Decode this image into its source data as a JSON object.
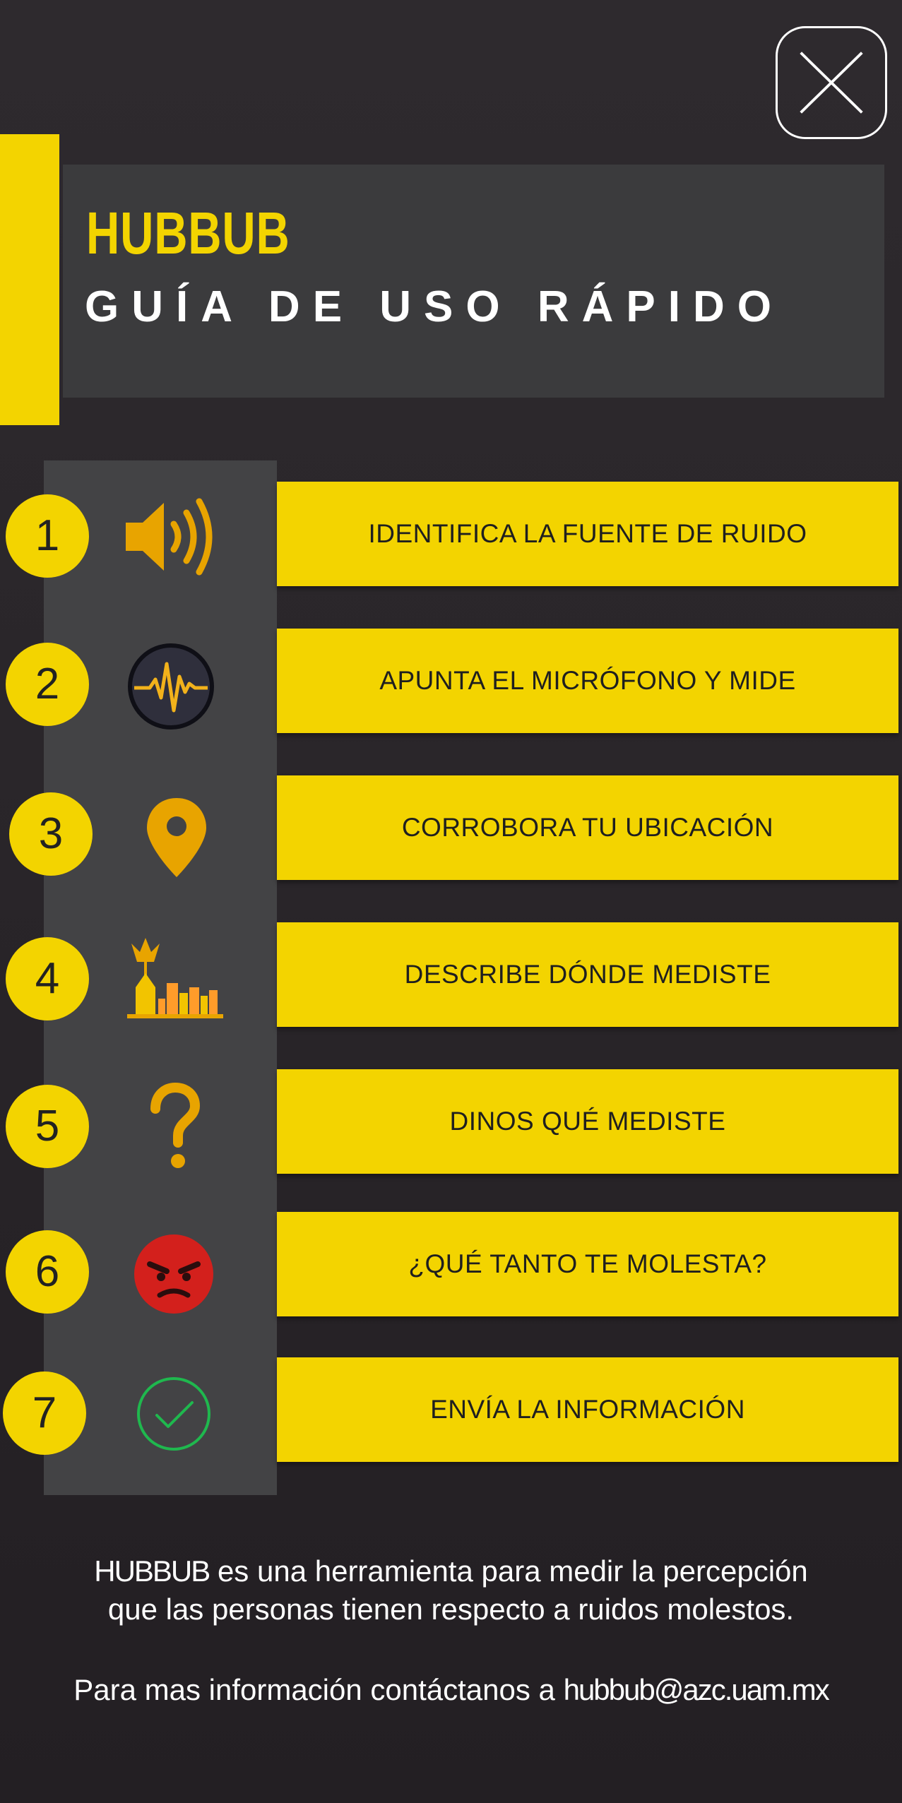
{
  "header": {
    "app_name": "HUBBUB",
    "title": "GUÍA DE USO RÁPIDO"
  },
  "close_button": {
    "icon": "close-icon"
  },
  "steps": [
    {
      "number": "1",
      "label": "IDENTIFICA LA FUENTE DE RUIDO",
      "icon": "speaker-icon"
    },
    {
      "number": "2",
      "label": "APUNTA EL MICRÓFONO Y MIDE",
      "icon": "sound-wave-icon"
    },
    {
      "number": "3",
      "label": "CORROBORA TU UBICACIÓN",
      "icon": "location-pin-icon"
    },
    {
      "number": "4",
      "label": "DESCRIBE DÓNDE MEDISTE",
      "icon": "city-skyline-icon"
    },
    {
      "number": "5",
      "label": "DINOS QUÉ MEDISTE",
      "icon": "question-mark-icon"
    },
    {
      "number": "6",
      "label": "¿QUÉ TANTO TE MOLESTA?",
      "icon": "angry-face-icon"
    },
    {
      "number": "7",
      "label": "ENVÍA LA INFORMACIÓN",
      "icon": "check-circle-icon"
    }
  ],
  "footer": {
    "brand": "HUBBUB",
    "line1_rest": " es una herramienta para medir la percepción",
    "line2": "que las personas tienen respecto a ruidos molestos.",
    "contact_prefix": "Para mas información contáctanos a ",
    "email": "hubbub@azc.uam.mx"
  },
  "colors": {
    "accent": "#f3d400",
    "background": "#2a262a",
    "panel": "#3b3b3d",
    "icon_column": "#434345"
  }
}
